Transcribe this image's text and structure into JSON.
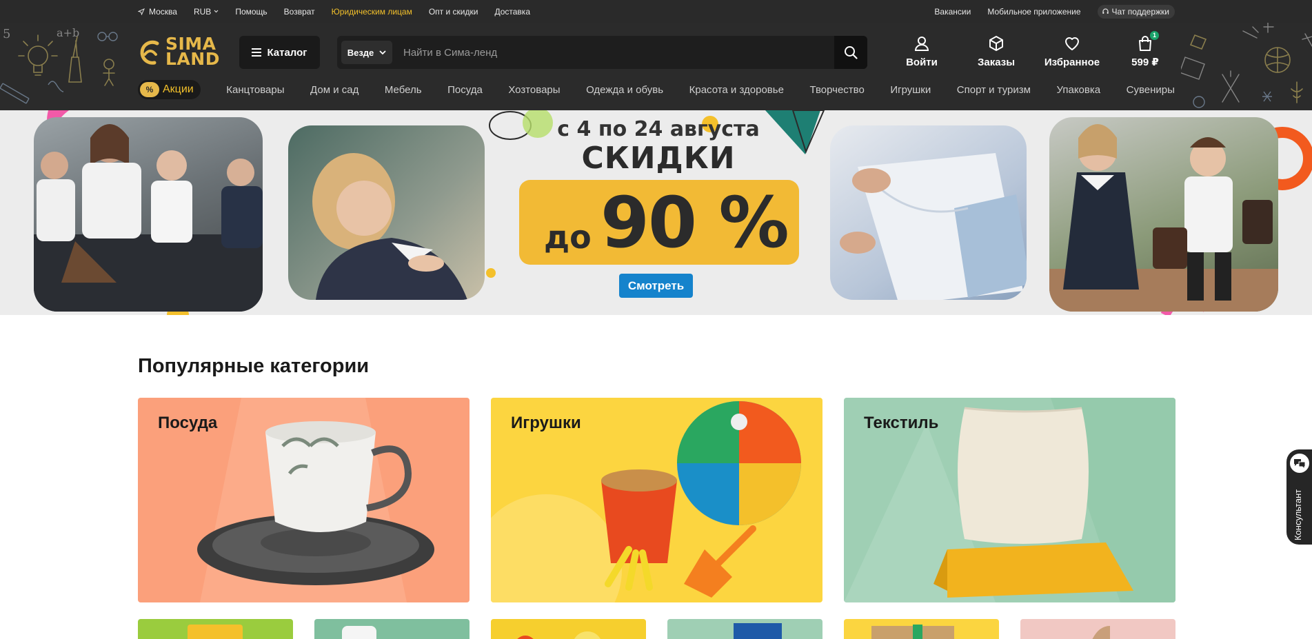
{
  "topbar": {
    "city": "Москва",
    "currency": "RUB",
    "links": [
      "Помощь",
      "Возврат",
      "Юридическим лицам",
      "Опт и скидки",
      "Доставка"
    ],
    "right_links": [
      "Вакансии",
      "Мобильное приложение"
    ],
    "support_chat": "Чат поддержки"
  },
  "header": {
    "logo_text": "SIMA LAND",
    "catalog_label": "Каталог",
    "search_scope": "Везде",
    "search_placeholder": "Найти в Сима-ленд",
    "actions": {
      "login": "Войти",
      "orders": "Заказы",
      "favorites": "Избранное",
      "cart_total": "599 ₽",
      "cart_count": "1"
    }
  },
  "catnav": {
    "promo_label": "Акции",
    "promo_badge": "%",
    "items": [
      "Канцтовары",
      "Дом и сад",
      "Мебель",
      "Посуда",
      "Хозтовары",
      "Одежда и обувь",
      "Красота и здоровье",
      "Творчество",
      "Игрушки",
      "Спорт и туризм",
      "Упаковка",
      "Сувениры"
    ]
  },
  "banner": {
    "dates": "с 4 по 24 августа",
    "headline": "СКИДКИ",
    "prefix": "до",
    "discount": "90 %",
    "cta": "Смотреть"
  },
  "popular": {
    "title": "Популярные категории",
    "cards": [
      "Посуда",
      "Игрушки",
      "Текстиль"
    ]
  },
  "consultant": {
    "label": "Консультант"
  },
  "colors": {
    "accent_yellow": "#f2ba35",
    "cta_blue": "#1583cc",
    "header_bg": "#2b2b2b"
  }
}
